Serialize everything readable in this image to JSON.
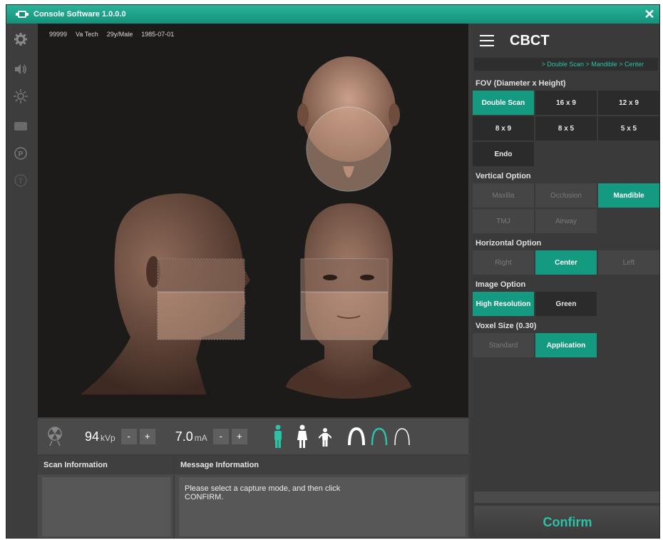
{
  "window": {
    "title": "Console Software  1.0.0.0",
    "close_icon": "close-icon"
  },
  "toolbar": {
    "icons": [
      "gear-icon",
      "speaker-icon",
      "sun-icon",
      "monitor-icon",
      "p-icon",
      "t-icon"
    ]
  },
  "patient": {
    "id": "99999",
    "name": "Va Tech",
    "age_sex": "29y/Male",
    "dob": "1985-07-01"
  },
  "controls": {
    "kvp_value": "94",
    "kvp_unit": "kVp",
    "ma_value": "7.0",
    "ma_unit": "mA",
    "minus": "-",
    "plus": "+",
    "accent_color": "#2bc2a6"
  },
  "scan_info": {
    "title": "Scan Information"
  },
  "message_info": {
    "title": "Message Information",
    "text": "Please select a capture mode, and then click CONFIRM."
  },
  "panel": {
    "title": "CBCT",
    "breadcrumb": "> Double Scan > Mandible > Center",
    "fov_label": "FOV (Diameter x Height)",
    "fov_options": [
      {
        "label": "Double Scan",
        "state": "active"
      },
      {
        "label": "16 x 9",
        "state": "normal"
      },
      {
        "label": "12 x 9",
        "state": "normal"
      },
      {
        "label": "8 x 9",
        "state": "normal"
      },
      {
        "label": "8 x 5",
        "state": "normal"
      },
      {
        "label": "5 x 5",
        "state": "normal"
      },
      {
        "label": "Endo",
        "state": "normal"
      }
    ],
    "vertical_label": "Vertical Option",
    "vertical_options": [
      {
        "label": "Maxilla",
        "state": "disabled"
      },
      {
        "label": "Occlusion",
        "state": "disabled"
      },
      {
        "label": "Mandible",
        "state": "active"
      },
      {
        "label": "TMJ",
        "state": "disabled"
      },
      {
        "label": "Airway",
        "state": "disabled"
      }
    ],
    "horizontal_label": "Horizontal Option",
    "horizontal_options": [
      {
        "label": "Right",
        "state": "disabled"
      },
      {
        "label": "Center",
        "state": "active"
      },
      {
        "label": "Left",
        "state": "disabled"
      }
    ],
    "image_label": "Image Option",
    "image_options": [
      {
        "label": "High Resolution",
        "state": "active"
      },
      {
        "label": "Green",
        "state": "normal"
      }
    ],
    "voxel_label": "Voxel Size (0.30)",
    "voxel_options": [
      {
        "label": "Standard",
        "state": "disabled"
      },
      {
        "label": "Application",
        "state": "active"
      }
    ],
    "confirm_label": "Confirm"
  }
}
